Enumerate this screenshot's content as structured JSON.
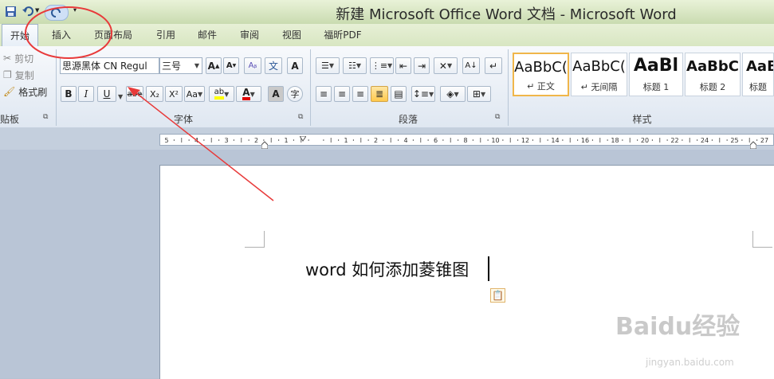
{
  "window": {
    "title": "新建 Microsoft Office Word 文档 - Microsoft Word"
  },
  "tabs": [
    "开始",
    "插入",
    "页面布局",
    "引用",
    "邮件",
    "审阅",
    "视图",
    "福昕PDF"
  ],
  "clipboard": {
    "cut": "剪切",
    "copy": "复制",
    "format_painter": "格式刷",
    "group_label": "贴板"
  },
  "font": {
    "name": "思源黑体 CN Regul",
    "size": "三号",
    "group_label": "字体",
    "bold": "B",
    "italic": "I",
    "underline": "U",
    "strike": "abe",
    "subscript": "X₂",
    "superscript": "X²",
    "change_case": "Aa",
    "grow": "A",
    "shrink": "A",
    "clear": "A",
    "wen": "文",
    "char_border": "A",
    "enclose": "字"
  },
  "paragraph": {
    "group_label": "段落"
  },
  "styles": {
    "group_label": "样式",
    "items": [
      {
        "sample": "AaBbC(",
        "name": "↵ 正文"
      },
      {
        "sample": "AaBbC(",
        "name": "↵ 无间隔"
      },
      {
        "sample": "AaBl",
        "name": "标题 1"
      },
      {
        "sample": "AaBbC",
        "name": "标题 2"
      },
      {
        "sample": "AaB",
        "name": "标题"
      }
    ]
  },
  "ruler": {
    "labels": [
      "5",
      "4",
      "3",
      "2",
      "1",
      "",
      "1",
      "2",
      "4",
      "6",
      "8",
      "10",
      "12",
      "14",
      "16",
      "18",
      "20",
      "22",
      "24",
      "25",
      "27"
    ]
  },
  "document": {
    "text": "word 如何添加菱锥图"
  },
  "watermark": {
    "text": "Baidu经验",
    "url": "jingyan.baidu.com"
  },
  "colors": {
    "annotation_red": "#e83a3a",
    "accent_blue": "#2b5797",
    "highlight_yellow": "#ffff00",
    "font_red": "#e00000"
  }
}
